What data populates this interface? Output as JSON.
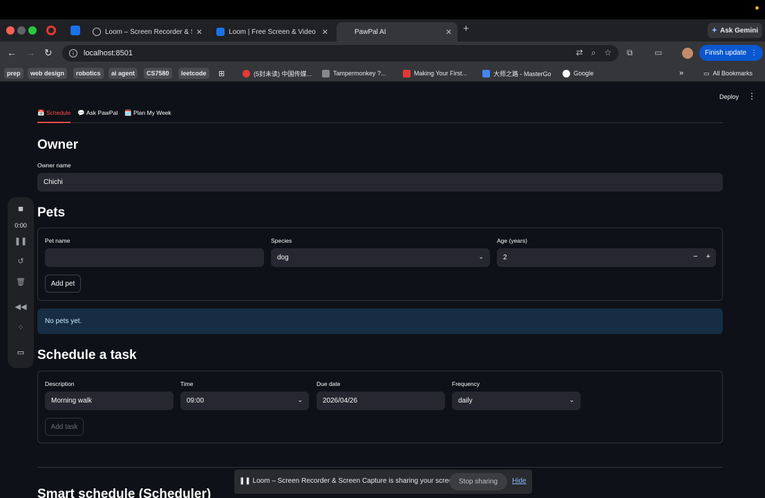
{
  "browser": {
    "tabs": [
      {
        "label": "Loom – Screen Recorder & Sc",
        "icon": "globe-icon",
        "color": "#bdc1c6"
      },
      {
        "label": "Loom | Free Screen & Video R",
        "icon": "loom-icon",
        "color": "#1a73e8"
      },
      {
        "label": "PawPal AI",
        "icon": "streamlit-icon",
        "color": "#35363a"
      }
    ],
    "ask_gemini": "Ask Gemini",
    "url": "localhost:8501",
    "finish_update": "Finish update",
    "bookmarks": [
      {
        "label": "prep",
        "pill": true
      },
      {
        "label": "web design",
        "pill": true
      },
      {
        "label": "robotics",
        "pill": true
      },
      {
        "label": "ai agent",
        "pill": true
      },
      {
        "label": "CS7580",
        "pill": true
      },
      {
        "label": "leetcode",
        "pill": true
      },
      {
        "label": "(5封未读) 中国传媒...",
        "pill": false,
        "color": "#e53935"
      },
      {
        "label": "Tampermonkey ?...",
        "pill": false,
        "color": "#888888"
      },
      {
        "label": "Making Your First...",
        "pill": false,
        "color": "#e53935"
      },
      {
        "label": "大师之路 - MasterGo",
        "pill": false,
        "color": "#4285f4"
      },
      {
        "label": "Google",
        "pill": false,
        "color": "#ffffff"
      }
    ],
    "all_bookmarks": "All Bookmarks"
  },
  "app": {
    "deploy": "Deploy",
    "tabs": [
      "📅 Schedule",
      "💬 Ask PawPal",
      "🗓️ Plan My Week"
    ],
    "owner": {
      "heading": "Owner",
      "name_label": "Owner name",
      "name_value": "Chichi"
    },
    "pets": {
      "heading": "Pets",
      "pet_name_label": "Pet name",
      "pet_name_value": "",
      "species_label": "Species",
      "species_value": "dog",
      "age_label": "Age (years)",
      "age_value": "2",
      "add_button": "Add pet",
      "empty_message": "No pets yet."
    },
    "task": {
      "heading": "Schedule a task",
      "description_label": "Description",
      "description_value": "Morning walk",
      "time_label": "Time",
      "time_value": "09:00",
      "due_label": "Due date",
      "due_value": "2026/04/26",
      "frequency_label": "Frequency",
      "frequency_value": "daily",
      "add_button": "Add task"
    },
    "smart_heading": "Smart schedule (Scheduler)"
  },
  "recorder": {
    "time": "0:00"
  },
  "sharebar": {
    "text": "Loom – Screen Recorder & Screen Capture is sharing your screen.",
    "stop": "Stop sharing",
    "hide": "Hide"
  }
}
